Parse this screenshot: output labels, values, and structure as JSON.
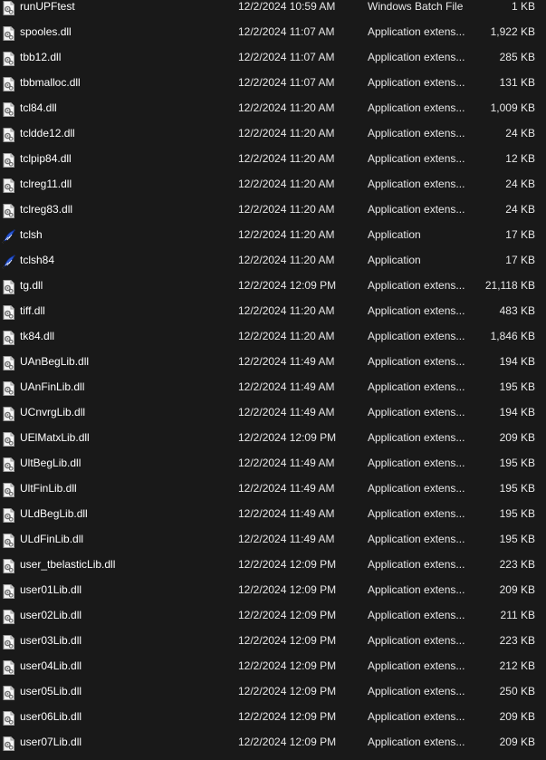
{
  "files": [
    {
      "name": "runUPFtest",
      "date": "12/2/2024 10:59 AM",
      "type": "Windows Batch File",
      "size": "1 KB",
      "icon": "batch-file-icon"
    },
    {
      "name": "spooles.dll",
      "date": "12/2/2024 11:07 AM",
      "type": "Application extens...",
      "size": "1,922 KB",
      "icon": "dll-file-icon"
    },
    {
      "name": "tbb12.dll",
      "date": "12/2/2024 11:07 AM",
      "type": "Application extens...",
      "size": "285 KB",
      "icon": "dll-file-icon"
    },
    {
      "name": "tbbmalloc.dll",
      "date": "12/2/2024 11:07 AM",
      "type": "Application extens...",
      "size": "131 KB",
      "icon": "dll-file-icon"
    },
    {
      "name": "tcl84.dll",
      "date": "12/2/2024 11:20 AM",
      "type": "Application extens...",
      "size": "1,009 KB",
      "icon": "dll-file-icon"
    },
    {
      "name": "tcldde12.dll",
      "date": "12/2/2024 11:20 AM",
      "type": "Application extens...",
      "size": "24 KB",
      "icon": "dll-file-icon"
    },
    {
      "name": "tclpip84.dll",
      "date": "12/2/2024 11:20 AM",
      "type": "Application extens...",
      "size": "12 KB",
      "icon": "dll-file-icon"
    },
    {
      "name": "tclreg11.dll",
      "date": "12/2/2024 11:20 AM",
      "type": "Application extens...",
      "size": "24 KB",
      "icon": "dll-file-icon"
    },
    {
      "name": "tclreg83.dll",
      "date": "12/2/2024 11:20 AM",
      "type": "Application extens...",
      "size": "24 KB",
      "icon": "dll-file-icon"
    },
    {
      "name": "tclsh",
      "date": "12/2/2024 11:20 AM",
      "type": "Application",
      "size": "17 KB",
      "icon": "tcl-feather-icon"
    },
    {
      "name": "tclsh84",
      "date": "12/2/2024 11:20 AM",
      "type": "Application",
      "size": "17 KB",
      "icon": "tcl-feather-icon"
    },
    {
      "name": "tg.dll",
      "date": "12/2/2024 12:09 PM",
      "type": "Application extens...",
      "size": "21,118 KB",
      "icon": "dll-file-icon"
    },
    {
      "name": "tiff.dll",
      "date": "12/2/2024 11:20 AM",
      "type": "Application extens...",
      "size": "483 KB",
      "icon": "dll-file-icon"
    },
    {
      "name": "tk84.dll",
      "date": "12/2/2024 11:20 AM",
      "type": "Application extens...",
      "size": "1,846 KB",
      "icon": "dll-file-icon"
    },
    {
      "name": "UAnBegLib.dll",
      "date": "12/2/2024 11:49 AM",
      "type": "Application extens...",
      "size": "194 KB",
      "icon": "dll-file-icon"
    },
    {
      "name": "UAnFinLib.dll",
      "date": "12/2/2024 11:49 AM",
      "type": "Application extens...",
      "size": "195 KB",
      "icon": "dll-file-icon"
    },
    {
      "name": "UCnvrgLib.dll",
      "date": "12/2/2024 11:49 AM",
      "type": "Application extens...",
      "size": "194 KB",
      "icon": "dll-file-icon"
    },
    {
      "name": "UElMatxLib.dll",
      "date": "12/2/2024 12:09 PM",
      "type": "Application extens...",
      "size": "209 KB",
      "icon": "dll-file-icon"
    },
    {
      "name": "UltBegLib.dll",
      "date": "12/2/2024 11:49 AM",
      "type": "Application extens...",
      "size": "195 KB",
      "icon": "dll-file-icon"
    },
    {
      "name": "UltFinLib.dll",
      "date": "12/2/2024 11:49 AM",
      "type": "Application extens...",
      "size": "195 KB",
      "icon": "dll-file-icon"
    },
    {
      "name": "ULdBegLib.dll",
      "date": "12/2/2024 11:49 AM",
      "type": "Application extens...",
      "size": "195 KB",
      "icon": "dll-file-icon"
    },
    {
      "name": "ULdFinLib.dll",
      "date": "12/2/2024 11:49 AM",
      "type": "Application extens...",
      "size": "195 KB",
      "icon": "dll-file-icon"
    },
    {
      "name": "user_tbelasticLib.dll",
      "date": "12/2/2024 12:09 PM",
      "type": "Application extens...",
      "size": "223 KB",
      "icon": "dll-file-icon"
    },
    {
      "name": "user01Lib.dll",
      "date": "12/2/2024 12:09 PM",
      "type": "Application extens...",
      "size": "209 KB",
      "icon": "dll-file-icon"
    },
    {
      "name": "user02Lib.dll",
      "date": "12/2/2024 12:09 PM",
      "type": "Application extens...",
      "size": "211 KB",
      "icon": "dll-file-icon"
    },
    {
      "name": "user03Lib.dll",
      "date": "12/2/2024 12:09 PM",
      "type": "Application extens...",
      "size": "223 KB",
      "icon": "dll-file-icon"
    },
    {
      "name": "user04Lib.dll",
      "date": "12/2/2024 12:09 PM",
      "type": "Application extens...",
      "size": "212 KB",
      "icon": "dll-file-icon"
    },
    {
      "name": "user05Lib.dll",
      "date": "12/2/2024 12:09 PM",
      "type": "Application extens...",
      "size": "250 KB",
      "icon": "dll-file-icon"
    },
    {
      "name": "user06Lib.dll",
      "date": "12/2/2024 12:09 PM",
      "type": "Application extens...",
      "size": "209 KB",
      "icon": "dll-file-icon"
    },
    {
      "name": "user07Lib.dll",
      "date": "12/2/2024 12:09 PM",
      "type": "Application extens...",
      "size": "209 KB",
      "icon": "dll-file-icon"
    }
  ]
}
